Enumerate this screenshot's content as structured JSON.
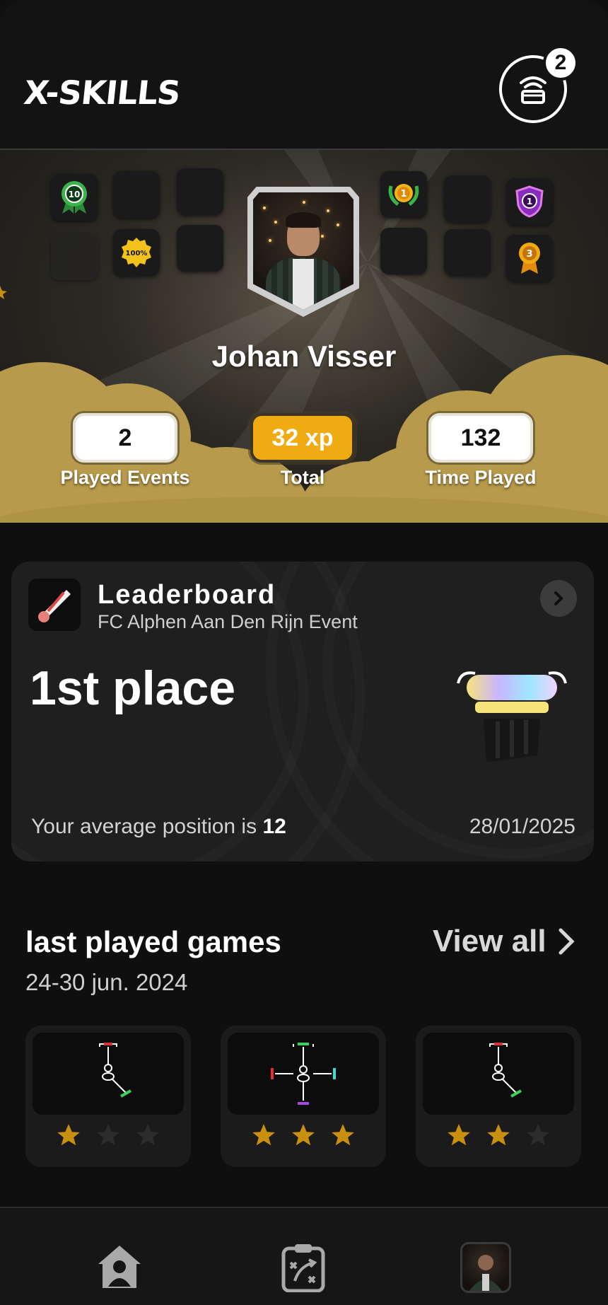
{
  "header": {
    "logo_text": "X-SKILLS",
    "notification_count": "2"
  },
  "profile": {
    "name": "Johan Visser",
    "stats": [
      {
        "value": "2",
        "label": "Played Events"
      },
      {
        "value": "32 xp",
        "label": "Total"
      },
      {
        "value": "132",
        "label": "Time Played"
      }
    ],
    "badges": {
      "b10": "10",
      "b100": "100%",
      "first": "1",
      "shield": "1",
      "medal": "3"
    }
  },
  "leaderboard": {
    "title": "Leaderboard",
    "event": "FC Alphen Aan Den Rijn Event",
    "place": "1st place",
    "avg_prefix": "Your average position is ",
    "avg_value": "12",
    "date": "28/01/2025"
  },
  "last_played": {
    "title": "last played games",
    "range": "24-30 jun. 2024",
    "view_all": "View all",
    "games": [
      {
        "stars": 1
      },
      {
        "stars": 3
      },
      {
        "stars": 2
      }
    ]
  },
  "colors": {
    "gold": "#f0aa12",
    "star_on": "#c9900f",
    "star_off": "#2c2c2c"
  }
}
